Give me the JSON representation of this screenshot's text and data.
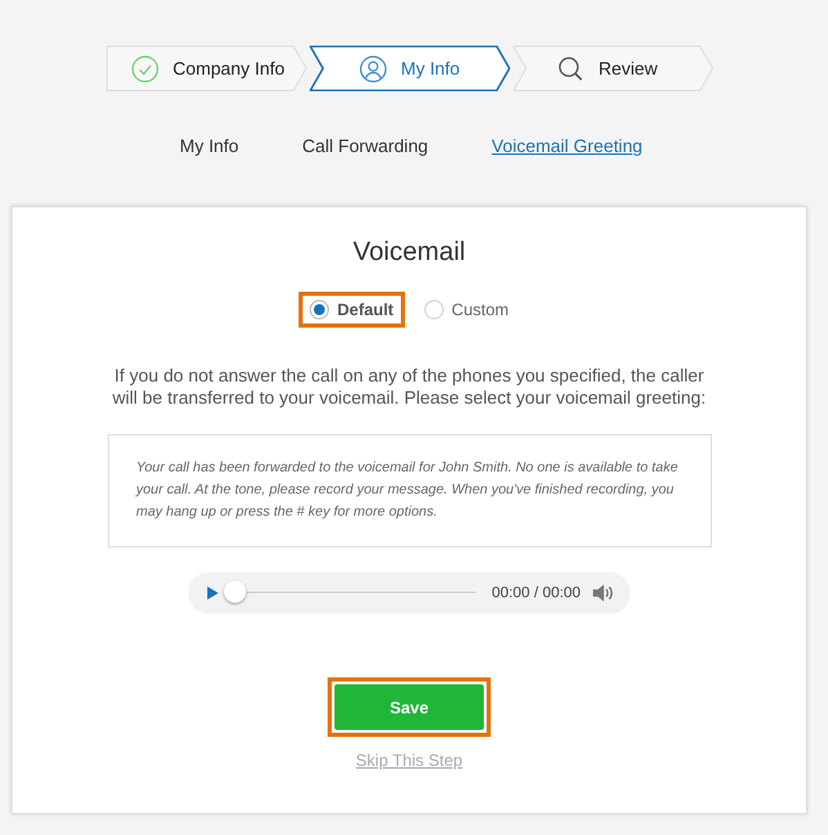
{
  "steps": [
    {
      "label": "Company Info",
      "kind": "done"
    },
    {
      "label": "My Info",
      "kind": "current"
    },
    {
      "label": "Review",
      "kind": "upcoming"
    }
  ],
  "subtabs": [
    {
      "label": "My Info",
      "selected": false
    },
    {
      "label": "Call Forwarding",
      "selected": false
    },
    {
      "label": "Voicemail Greeting",
      "selected": true
    }
  ],
  "card": {
    "title": "Voicemail",
    "options": [
      {
        "label": "Default",
        "selected": true,
        "highlighted": true
      },
      {
        "label": "Custom",
        "selected": false,
        "highlighted": false
      }
    ],
    "instructions": "If you do not answer the call on any of the phones you specified, the caller will be transferred to your voicemail. Please select your voicemail greeting:",
    "greeting": "Your call has been forwarded to the voicemail for John Smith. No one is available to take your call. At the tone, please record your message. When you've finished recording, you may hang up or press the # key for more options.",
    "player": {
      "level": 0,
      "time": "00:00 / 00:00"
    },
    "save_button": {
      "label": "Save",
      "highlighted": true
    },
    "skip_link": "Skip This Step"
  }
}
